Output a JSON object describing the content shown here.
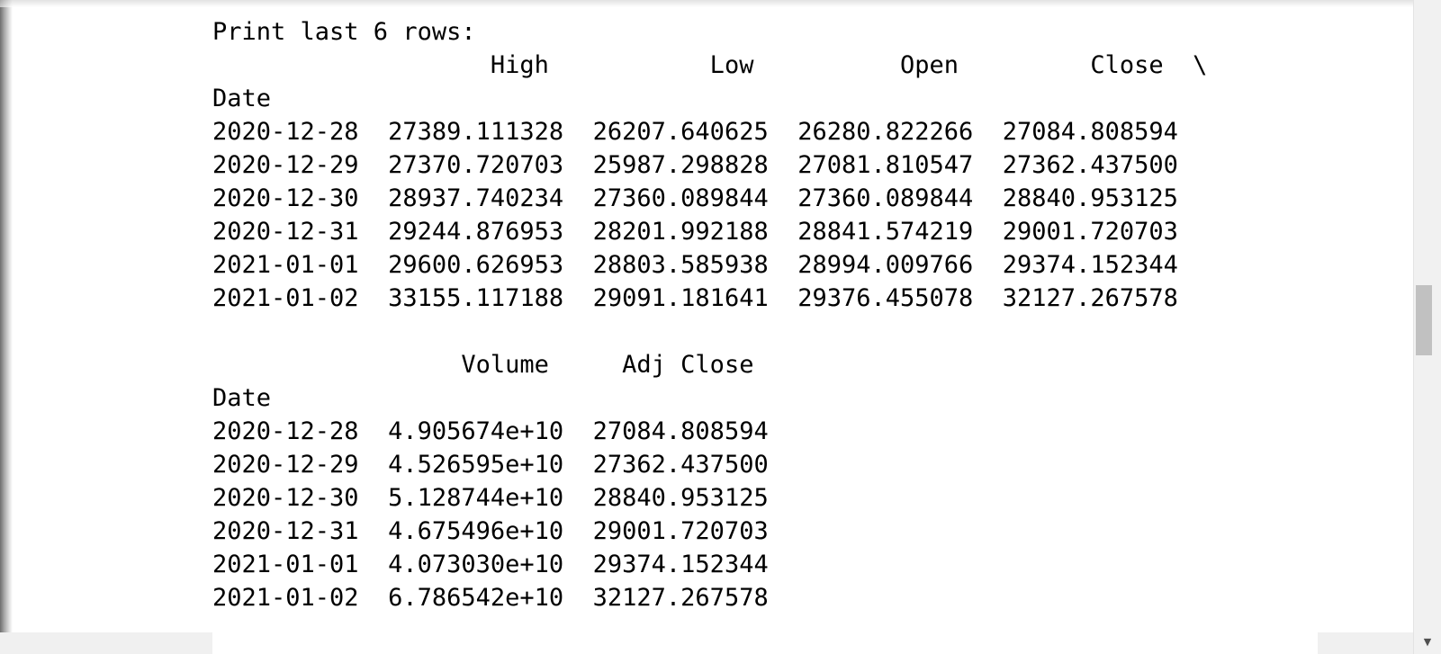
{
  "output": {
    "lines": [
      "Print last 6 rows:",
      "                   High           Low          Open         Close  \\",
      "Date",
      "2020-12-28  27389.111328  26207.640625  26280.822266  27084.808594",
      "2020-12-29  27370.720703  25987.298828  27081.810547  27362.437500",
      "2020-12-30  28937.740234  27360.089844  27360.089844  28840.953125",
      "2020-12-31  29244.876953  28201.992188  28841.574219  29001.720703",
      "2021-01-01  29600.626953  28803.585938  28994.009766  29374.152344",
      "2021-01-02  33155.117188  29091.181641  29376.455078  32127.267578",
      "",
      "                 Volume     Adj Close",
      "Date",
      "2020-12-28  4.905674e+10  27084.808594",
      "2020-12-29  4.526595e+10  27362.437500",
      "2020-12-30  5.128744e+10  28840.953125",
      "2020-12-31  4.675496e+10  29001.720703",
      "2021-01-01  4.073030e+10  29374.152344",
      "2021-01-02  6.786542e+10  32127.267578"
    ]
  },
  "scrollbar": {
    "down_arrow_icon": "chevron-down-icon",
    "thumb_color": "#c1c1c1",
    "track_color": "#f1f1f1"
  }
}
